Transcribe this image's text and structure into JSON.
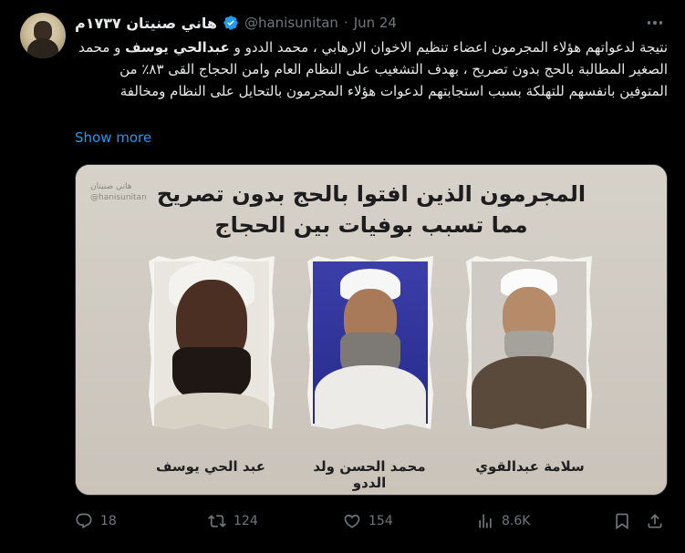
{
  "tweet": {
    "author_name": "هاني صنيتان ١٧٣٧م",
    "handle": "@hanisunitan",
    "separator": "·",
    "date": "Jun 24",
    "text_part1": "نتيجة لدعواتهم هؤلاء المجرمون اعضاء تنظيم الاخوان الارهابي ، محمد الددو و ",
    "text_bold1": "عبدالحي يوسف",
    "text_part2": " و محمد الصغير المطالبة بالحج بدون تصريح ، بهدف التشغيب على النظام العام وامن الحجاج القى ٨٣٪ من المتوفين بانفسهم للتهلكة بسبب استجابتهم لدعوات هؤلاء المجرمون بالتحايل على النظام ومخالفة",
    "show_more": "Show more"
  },
  "media": {
    "watermark_line1": "هاني صنيتان",
    "watermark_line2": "@hanisunitan",
    "headline_line1": "المجرمون الذين افتوا بالحج بدون تصريح",
    "headline_line2": "مما تسبب بوفيات بين الحجاج",
    "captions": [
      "عبد الحي يوسف",
      "محمد الحسن ولد الددو",
      "سلامة عبدالقوي"
    ]
  },
  "actions": {
    "replies": "18",
    "reposts": "124",
    "likes": "154",
    "views": "8.6K"
  },
  "colors": {
    "background": "#000000",
    "text": "#e7e9ea",
    "muted": "#71767b",
    "link": "#1d9bf0",
    "verified": "#1d9bf0"
  },
  "icons": [
    "verified-badge-icon",
    "more-options-icon",
    "reply-icon",
    "repost-icon",
    "like-icon",
    "views-icon",
    "bookmark-icon",
    "share-icon"
  ]
}
